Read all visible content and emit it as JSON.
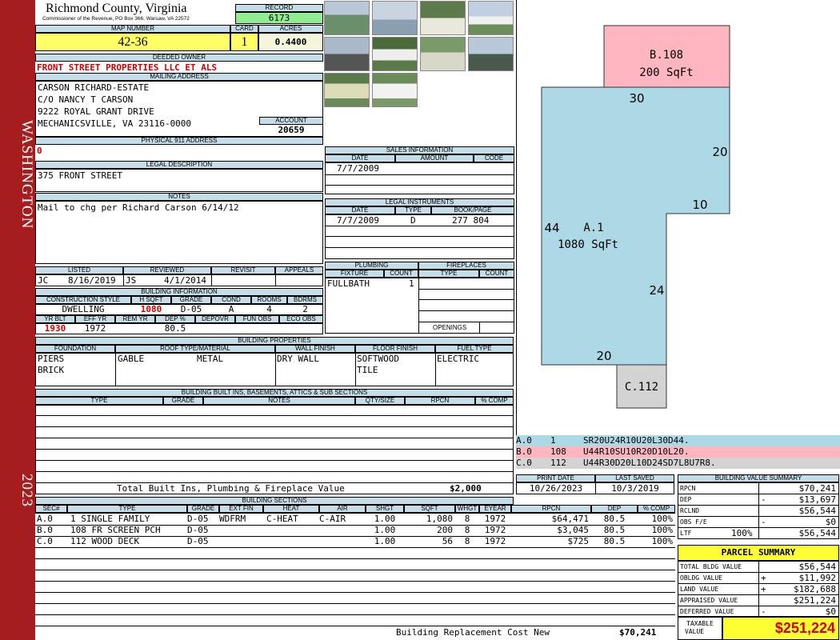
{
  "sidebar": {
    "district": "WASHINGTON",
    "year": "2023"
  },
  "header": {
    "county": "Richmond County, Virginia",
    "address_line": "Commissioner of the Revenue, PO Box 366, Warsaw, VA 22572",
    "record_label": "RECORD",
    "record": "6173",
    "map_number_label": "MAP NUMBER",
    "map_number": "42-36",
    "card_label": "CARD",
    "card": "1",
    "acres_label": "ACRES",
    "acres": "0.4400"
  },
  "owner": {
    "deeded_label": "DEEDED OWNER",
    "deeded": "FRONT STREET PROPERTIES LLC ET ALS",
    "mailing_label": "MAILING ADDRESS",
    "mailing": [
      "CARSON RICHARD-ESTATE",
      "C/O NANCY T CARSON",
      "9222 ROYAL GRANT DRIVE",
      "MECHANICSVILLE, VA 23116-0000"
    ],
    "account_label": "ACCOUNT",
    "account": "20659",
    "physical_label": "PHYSICAL 911 ADDRESS",
    "physical": "0"
  },
  "legal": {
    "label": "LEGAL DESCRIPTION",
    "text": "375 FRONT STREET"
  },
  "notes": {
    "label": "NOTES",
    "text": "Mail to chg per Richard Carson 6/14/12"
  },
  "status": {
    "listed_label": "LISTED",
    "reviewed_label": "REVIEWED",
    "revisit_label": "REVISIT",
    "appeals_label": "APPEALS",
    "listed_by": "JC",
    "listed_date": "8/16/2019",
    "reviewed_by": "JS",
    "reviewed_date": "4/1/2014"
  },
  "building": {
    "label": "BUILDING INFORMATION",
    "h": [
      "CONSTRUCTION STYLE",
      "H SQFT",
      "GRADE",
      "COND",
      "ROOMS",
      "BDRMS"
    ],
    "v": [
      "DWELLING",
      "1080",
      "D-05",
      "A",
      "4",
      "2"
    ],
    "h2": [
      "YR BLT",
      "EFF YR",
      "REM YR",
      "DEP %",
      "DEPOVR",
      "FUN OBS",
      "ECO OBS"
    ],
    "v2": [
      "1930",
      "1972",
      "",
      "80.5",
      "",
      "",
      ""
    ]
  },
  "sales": {
    "label": "SALES INFORMATION",
    "cols": [
      "DATE",
      "AMOUNT",
      "CODE"
    ],
    "rows": [
      [
        "7/7/2009",
        "",
        ""
      ]
    ]
  },
  "legal_instruments": {
    "label": "LEGAL INSTRUMENTS",
    "cols": [
      "DATE",
      "TYPE",
      "BOOK/PAGE"
    ],
    "rows": [
      [
        "7/7/2009",
        "D",
        "277 804"
      ]
    ]
  },
  "plumbing": {
    "label": "PLUMBING",
    "cols": [
      "FIXTURE",
      "COUNT"
    ],
    "rows": [
      [
        "FULLBATH",
        "1"
      ]
    ]
  },
  "fireplaces": {
    "label": "FIREPLACES",
    "cols": [
      "TYPE",
      "COUNT"
    ],
    "openings": "OPENINGS"
  },
  "properties": {
    "label": "BUILDING PROPERTIES",
    "cols": [
      "FOUNDATION",
      "ROOF TYPE/MATERIAL",
      "WALL FINISH",
      "FLOOR FINISH",
      "FUEL TYPE"
    ],
    "foundation": [
      "PIERS",
      "BRICK"
    ],
    "roof_type": "GABLE",
    "roof_material": "METAL",
    "wall": "DRY WALL",
    "floor": [
      "SOFTWOOD",
      "TILE"
    ],
    "fuel": "ELECTRIC"
  },
  "builtins": {
    "label": "BUILDING BUILT INS, BASEMENTS, ATTICS & SUB SECTIONS",
    "cols": [
      "TYPE",
      "GRADE",
      "NOTES",
      "QTY/SIZE",
      "RPCN",
      "% COMP"
    ],
    "total_label": "Total Built Ins, Plumbing & Fireplace Value",
    "total": "$2,000"
  },
  "sections": {
    "label": "BUILDING SECTIONS",
    "cols": [
      "SEC#",
      "TYPE",
      "GRADE",
      "EXT FIN",
      "HEAT",
      "AIR",
      "SHGT",
      "SQFT",
      "WHGT",
      "EYEAR",
      "RPCN",
      "DEP",
      "% COMP"
    ],
    "rows": [
      [
        "A.0",
        "1 SINGLE FAMILY",
        "D-05",
        "WDFRM",
        "C-HEAT",
        "C-AIR",
        "1.00",
        "1,080",
        "8",
        "1972",
        "$64,471",
        "80.5",
        "100%"
      ],
      [
        "B.0",
        "108 FR SCREEN PCH",
        "D-05",
        "",
        "",
        "",
        "1.00",
        "200",
        "8",
        "1972",
        "$3,045",
        "80.5",
        "100%"
      ],
      [
        "C.0",
        "112 WOOD DECK",
        "D-05",
        "",
        "",
        "",
        "1.00",
        "56",
        "8",
        "1972",
        "$725",
        "80.5",
        "100%"
      ]
    ],
    "total_label": "Building Replacement Cost New",
    "total": "$70,241"
  },
  "sketch": {
    "b_label": "B.108",
    "b_area": "200 SqFt",
    "a_label": "A.1",
    "a_area": "1080 SqFt",
    "c_label": "C.112",
    "dims": [
      "30",
      "20",
      "10",
      "44",
      "24",
      "20"
    ],
    "legend": [
      {
        "sec": "A.0",
        "code": "1",
        "path": "SR20U24R10U20L30D44.",
        "color": "#add8e6"
      },
      {
        "sec": "B.0",
        "code": "108",
        "path": "U44R10SU10R20D10L20.",
        "color": "#ffb6c1"
      },
      {
        "sec": "C.0",
        "code": "112",
        "path": "U44R30D20L10D24SD7L8U7R8.",
        "color": "#d3d3d3"
      }
    ]
  },
  "dates": {
    "print_label": "PRINT DATE",
    "print": "10/26/2023",
    "saved_label": "LAST SAVED",
    "saved": "10/3/2019"
  },
  "bvs": {
    "label": "BUILDING VALUE SUMMARY",
    "rows": [
      {
        "k": "RPCN",
        "s": "",
        "v": "$70,241"
      },
      {
        "k": "DEP",
        "s": "-",
        "v": "$13,697"
      },
      {
        "k": "RCLND",
        "s": "",
        "v": "$56,544"
      },
      {
        "k": "OBS F/E",
        "s": "-",
        "v": "$0"
      },
      {
        "k": "LTF",
        "p": "100%",
        "s": "",
        "v": "$56,544"
      }
    ]
  },
  "parcel": {
    "label": "PARCEL SUMMARY",
    "rows": [
      {
        "k": "TOTAL BLDG VALUE",
        "s": "",
        "v": "$56,544"
      },
      {
        "k": "OBLDG VALUE",
        "s": "+",
        "v": "$11,992"
      },
      {
        "k": "LAND VALUE",
        "s": "+",
        "v": "$182,688"
      },
      {
        "k": "APPRAISED VALUE",
        "s": "",
        "v": "$251,224"
      },
      {
        "k": "DEFERRED VALUE",
        "s": "-",
        "v": "$0"
      }
    ],
    "taxable_label1": "TAXABLE",
    "taxable_label2": "VALUE",
    "taxable": "$251,224"
  }
}
